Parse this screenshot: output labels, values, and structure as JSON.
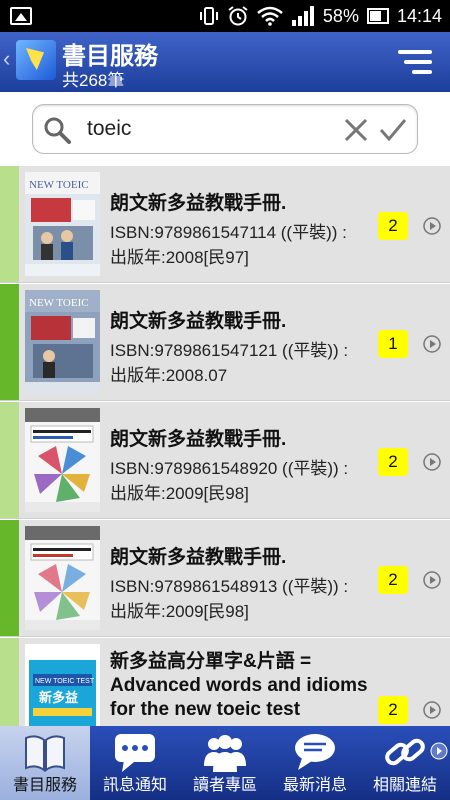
{
  "status_bar": {
    "battery_percent": "58%",
    "time": "14:14"
  },
  "header": {
    "title": "書目服務",
    "count": "共268筆"
  },
  "search": {
    "query": "toeic"
  },
  "results": [
    {
      "title": "朗文新多益教戰手冊.",
      "isbn": "ISBN:9789861547114 ((平裝)) :",
      "year": "出版年:2008[民97]",
      "count": "2",
      "cover": "NEW TOEIC"
    },
    {
      "title": "朗文新多益教戰手冊.",
      "isbn": "ISBN:9789861547121 ((平裝)) :",
      "year": "出版年:2008.07",
      "count": "1",
      "cover": "NEW TOEIC"
    },
    {
      "title": "朗文新多益教戰手冊.",
      "isbn": "ISBN:9789861548920 ((平裝)) :",
      "year": "出版年:2009[民98]",
      "count": "2"
    },
    {
      "title": "朗文新多益教戰手冊.",
      "isbn": "ISBN:9789861548913 ((平裝)) :",
      "year": "出版年:2009[民98]",
      "count": "2"
    },
    {
      "title_lines": [
        "新多益高分單字&片語 =",
        "Advanced words and idioms",
        "for the new toeic test"
      ],
      "count": "2",
      "cover": "NEW TOEIC TEST",
      "cover_sub": "新多益"
    }
  ],
  "tabs": [
    {
      "label": "書目服務",
      "icon": "book-icon"
    },
    {
      "label": "訊息通知",
      "icon": "chat-bubble-icon"
    },
    {
      "label": "讀者專區",
      "icon": "users-icon"
    },
    {
      "label": "最新消息",
      "icon": "speech-icon"
    },
    {
      "label": "相關連結",
      "icon": "link-icon"
    }
  ],
  "colors": {
    "header_top": "#3f63c8",
    "header_bottom": "#1d3f9c",
    "accent_green_dark": "#66b82a",
    "accent_green_light": "#b8df8c",
    "badge_yellow": "#ffff00",
    "list_bg": "#e2e2e2"
  }
}
